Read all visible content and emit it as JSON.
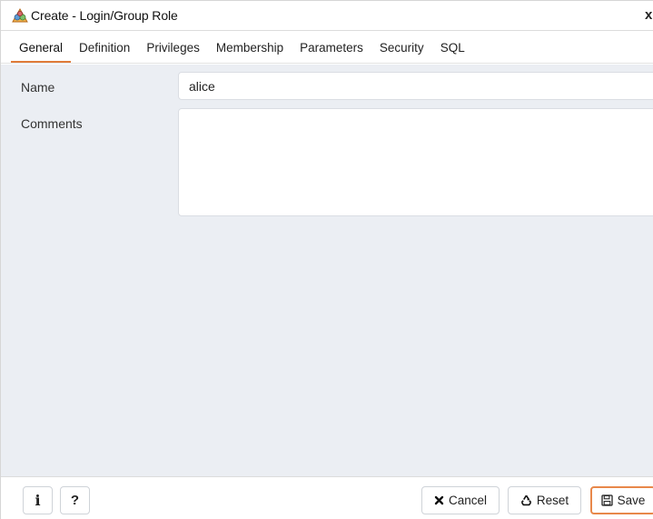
{
  "window": {
    "title": "Create - Login/Group Role",
    "close_label": "x"
  },
  "tabs": [
    {
      "label": "General",
      "active": true
    },
    {
      "label": "Definition",
      "active": false
    },
    {
      "label": "Privileges",
      "active": false
    },
    {
      "label": "Membership",
      "active": false
    },
    {
      "label": "Parameters",
      "active": false
    },
    {
      "label": "Security",
      "active": false
    },
    {
      "label": "SQL",
      "active": false
    }
  ],
  "form": {
    "name_label": "Name",
    "name_value": "alice",
    "comments_label": "Comments",
    "comments_value": ""
  },
  "footer": {
    "info_label": "i",
    "help_label": "?",
    "cancel_label": "Cancel",
    "reset_label": "Reset",
    "save_label": "Save"
  },
  "colors": {
    "accent": "#e07b39",
    "content_bg": "#ebeef3"
  },
  "icons": {
    "app": "role-icon",
    "cancel": "times-icon",
    "reset": "recycle-icon",
    "save": "floppy-disk-icon"
  }
}
